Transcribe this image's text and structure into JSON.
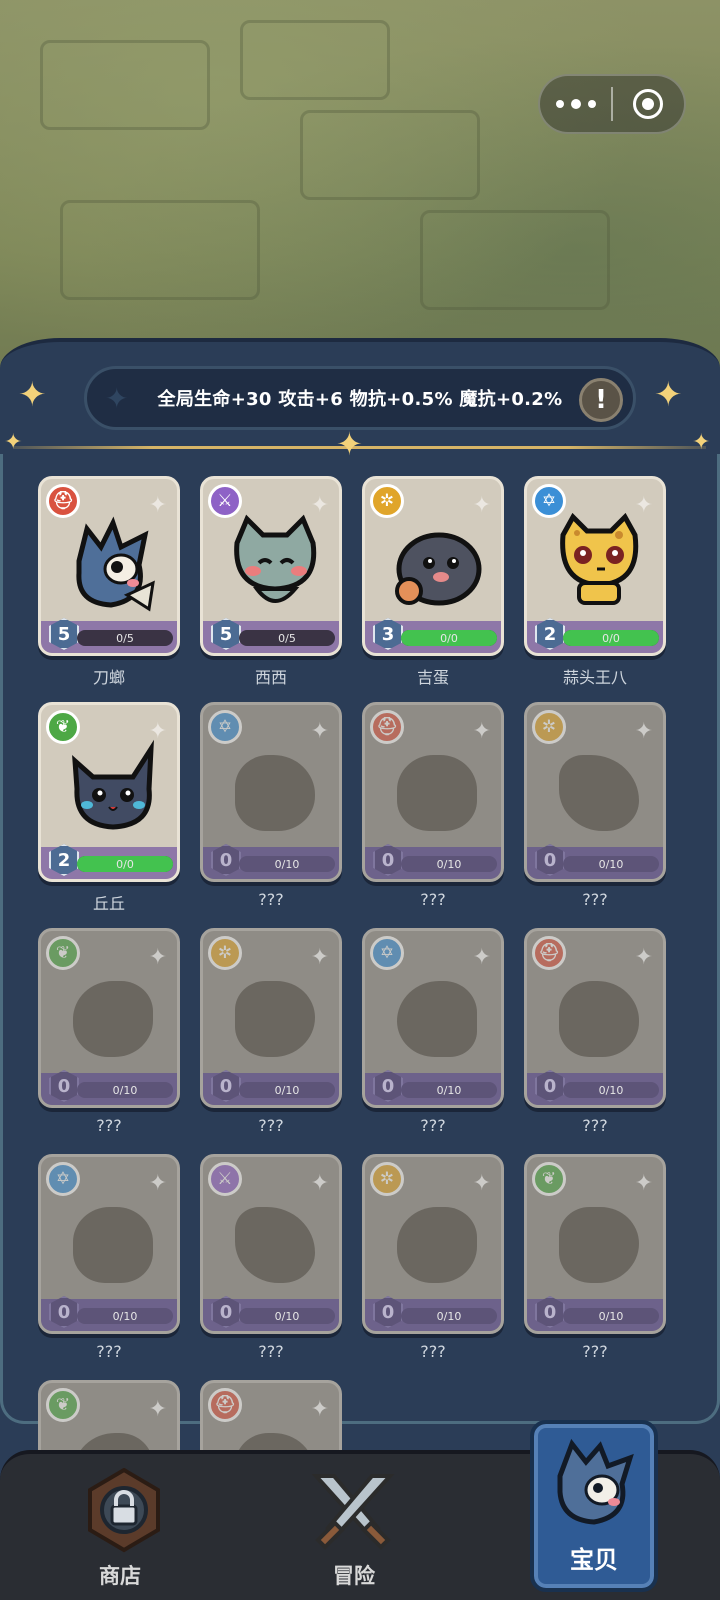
{
  "bonus": {
    "text": "全局生命+30 攻击+6 物抗+0.5% 魔抗+0.2%",
    "info_icon": "exclamation-icon"
  },
  "miniprogram_capsule": {
    "more_icon": "more-dots-icon",
    "close_icon": "target-circle-icon"
  },
  "element_colors": {
    "red": "#d9523f",
    "purple": "#8e62c6",
    "yellow": "#e0a52a",
    "blue": "#3b8fd6",
    "green": "#4da845"
  },
  "cards": [
    {
      "name": "刀螂",
      "level": "5",
      "progress": "0/5",
      "progress_ratio": 0,
      "element": "red",
      "element_icon": "helmet-icon",
      "locked": false
    },
    {
      "name": "西西",
      "level": "5",
      "progress": "0/5",
      "progress_ratio": 0,
      "element": "purple",
      "element_icon": "sword-icon",
      "locked": false
    },
    {
      "name": "吉蛋",
      "level": "3",
      "progress": "0/0",
      "progress_ratio": 1,
      "element": "yellow",
      "element_icon": "sun-icon",
      "locked": false
    },
    {
      "name": "蒜头王八",
      "level": "2",
      "progress": "0/0",
      "progress_ratio": 1,
      "element": "blue",
      "element_icon": "star-of-david-icon",
      "locked": false
    },
    {
      "name": "丘丘",
      "level": "2",
      "progress": "0/0",
      "progress_ratio": 1,
      "element": "green",
      "element_icon": "leaf-icon",
      "locked": false
    },
    {
      "name": "???",
      "level": "0",
      "progress": "0/10",
      "progress_ratio": 0,
      "element": "blue",
      "element_icon": "star-of-david-icon",
      "locked": true
    },
    {
      "name": "???",
      "level": "0",
      "progress": "0/10",
      "progress_ratio": 0,
      "element": "red",
      "element_icon": "helmet-icon",
      "locked": true
    },
    {
      "name": "???",
      "level": "0",
      "progress": "0/10",
      "progress_ratio": 0,
      "element": "yellow",
      "element_icon": "sun-icon",
      "locked": true
    },
    {
      "name": "???",
      "level": "0",
      "progress": "0/10",
      "progress_ratio": 0,
      "element": "green",
      "element_icon": "leaf-icon",
      "locked": true
    },
    {
      "name": "???",
      "level": "0",
      "progress": "0/10",
      "progress_ratio": 0,
      "element": "yellow",
      "element_icon": "sun-icon",
      "locked": true
    },
    {
      "name": "???",
      "level": "0",
      "progress": "0/10",
      "progress_ratio": 0,
      "element": "blue",
      "element_icon": "star-of-david-icon",
      "locked": true
    },
    {
      "name": "???",
      "level": "0",
      "progress": "0/10",
      "progress_ratio": 0,
      "element": "red",
      "element_icon": "helmet-icon",
      "locked": true
    },
    {
      "name": "???",
      "level": "0",
      "progress": "0/10",
      "progress_ratio": 0,
      "element": "blue",
      "element_icon": "star-of-david-icon",
      "locked": true
    },
    {
      "name": "???",
      "level": "0",
      "progress": "0/10",
      "progress_ratio": 0,
      "element": "purple",
      "element_icon": "sword-icon",
      "locked": true
    },
    {
      "name": "???",
      "level": "0",
      "progress": "0/10",
      "progress_ratio": 0,
      "element": "yellow",
      "element_icon": "sun-icon",
      "locked": true
    },
    {
      "name": "???",
      "level": "0",
      "progress": "0/10",
      "progress_ratio": 0,
      "element": "green",
      "element_icon": "leaf-icon",
      "locked": true
    },
    {
      "name": "",
      "level": "",
      "progress": "",
      "progress_ratio": 0,
      "element": "green",
      "element_icon": "leaf-icon",
      "locked": true
    },
    {
      "name": "",
      "level": "",
      "progress": "",
      "progress_ratio": 0,
      "element": "red",
      "element_icon": "helmet-icon",
      "locked": true
    }
  ],
  "tabs": [
    {
      "label": "商店",
      "icon": "locked-shop-icon",
      "active": false
    },
    {
      "label": "冒险",
      "icon": "crossed-swords-icon",
      "active": false
    },
    {
      "label": "宝贝",
      "icon": "pet-creature-icon",
      "active": true
    }
  ]
}
